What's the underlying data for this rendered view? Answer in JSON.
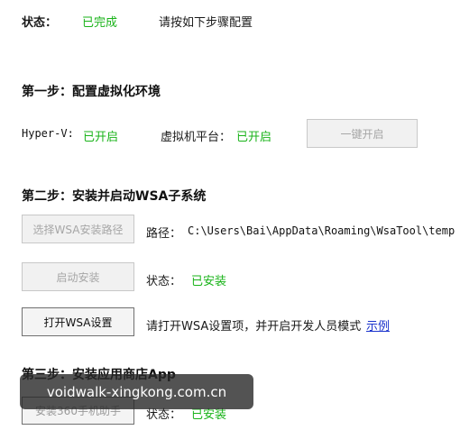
{
  "status_row": {
    "label": "状态：",
    "value": "已完成",
    "instruction": "请按如下步骤配置"
  },
  "step1": {
    "title": "第一步：配置虚拟化环境",
    "hyperv_label": "Hyper-V:",
    "hyperv_value": "已开启",
    "vmp_label": "虚拟机平台：",
    "vmp_value": "已开启",
    "enable_button": "一键开启"
  },
  "step2": {
    "title": "第二步：安装并启动WSA子系统",
    "select_path_button": "选择WSA安装路径",
    "path_label": "路径：",
    "path_value": "C:\\Users\\Bai\\AppData\\Roaming\\WsaTool\\temp",
    "start_install_button": "启动安装",
    "install_status_label": "状态：",
    "install_status_value": "已安装",
    "open_settings_button": "打开WSA设置",
    "settings_hint": "请打开WSA设置项，并开启开发人员模式",
    "example_link": "示例"
  },
  "step3": {
    "title": "第三步：安装应用商店App",
    "install_360_button": "安装360手机助手",
    "status_label": "状态：",
    "status_value": "已安装"
  },
  "watermark": {
    "text": "voidwalk-xingkong.com.cn"
  },
  "colors": {
    "status_green": "#19b319",
    "link_blue": "#1a33cc"
  }
}
